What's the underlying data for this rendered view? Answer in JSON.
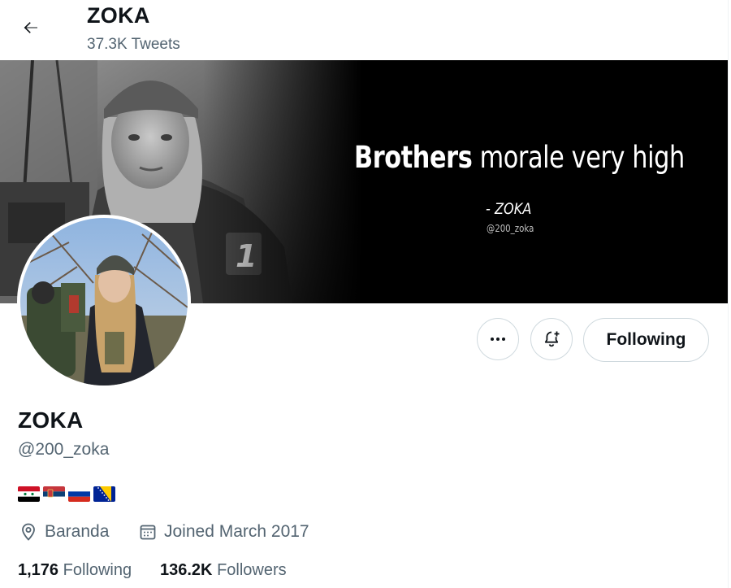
{
  "header": {
    "title": "ZOKA",
    "tweet_count": "37.3K Tweets"
  },
  "banner": {
    "quote_bold": "Brothers",
    "quote_rest": " morale very high",
    "quote_author": "- ZOKA",
    "quote_handle": "@200_zoka"
  },
  "actions": {
    "following_label": "Following"
  },
  "profile": {
    "name": "ZOKA",
    "handle": "@200_zoka",
    "location": "Baranda",
    "joined": "Joined March 2017",
    "following_count": "1,176",
    "following_label": "Following",
    "followers_count": "136.2K",
    "followers_label": "Followers"
  },
  "icons": {
    "back": "arrow-left-icon",
    "more": "more-horizontal-icon",
    "notify": "bell-plus-icon",
    "location": "location-pin-icon",
    "calendar": "calendar-icon"
  },
  "colors": {
    "text_primary": "#0f1419",
    "text_secondary": "#536471",
    "border": "#cfd9de"
  }
}
